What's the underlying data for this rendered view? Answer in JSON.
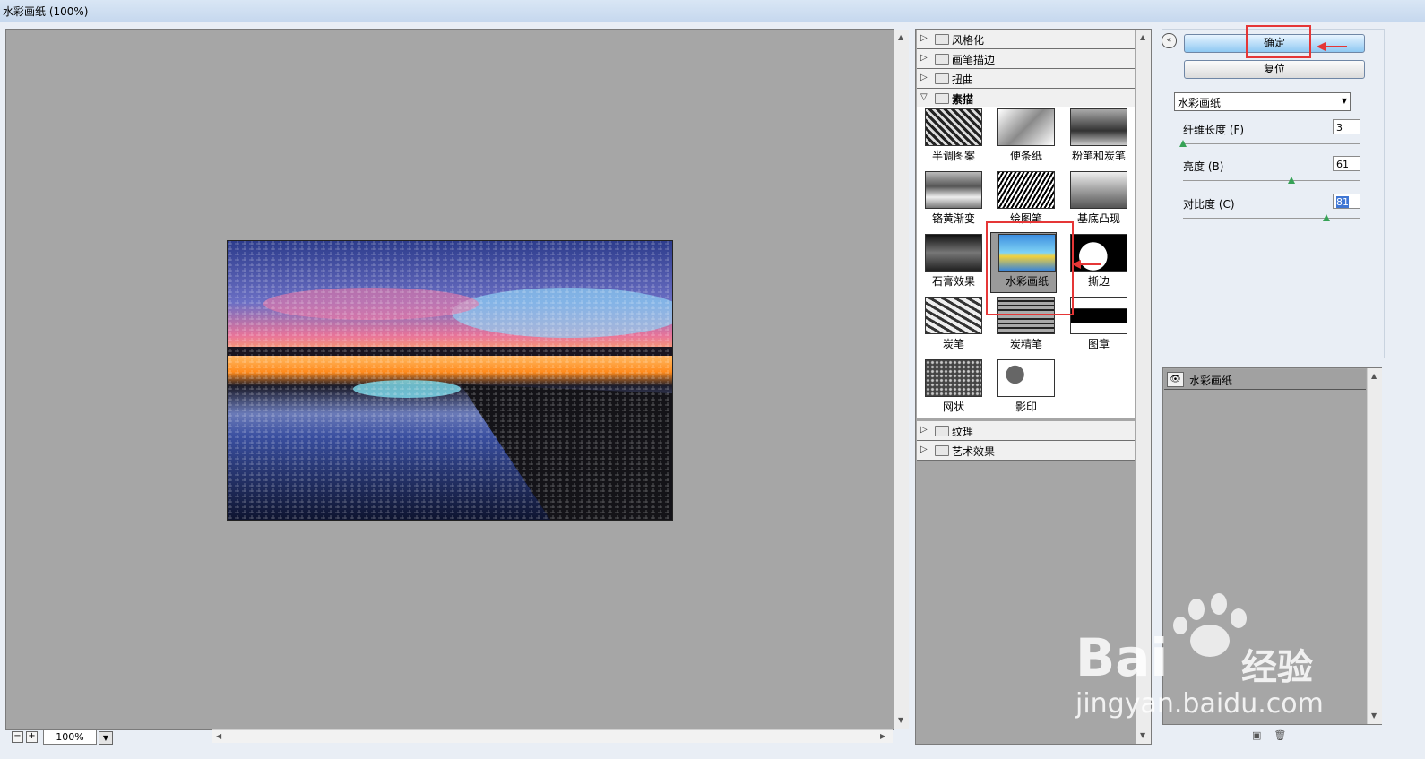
{
  "window": {
    "title": "水彩画纸 (100%)"
  },
  "preview": {
    "zoom": "100%",
    "zoom_out": "−",
    "zoom_in": "+"
  },
  "filter_categories_top": [
    {
      "label": "风格化",
      "open": false
    },
    {
      "label": "画笔描边",
      "open": false
    },
    {
      "label": "扭曲",
      "open": false
    },
    {
      "label": "素描",
      "open": true
    }
  ],
  "sketch_filters": [
    {
      "label": "半调图案"
    },
    {
      "label": "便条纸"
    },
    {
      "label": "粉笔和炭笔"
    },
    {
      "label": "铬黄渐变"
    },
    {
      "label": "绘图笔"
    },
    {
      "label": "基底凸现"
    },
    {
      "label": "石膏效果"
    },
    {
      "label": "水彩画纸",
      "selected": true
    },
    {
      "label": "撕边"
    },
    {
      "label": "炭笔"
    },
    {
      "label": "炭精笔"
    },
    {
      "label": "图章"
    },
    {
      "label": "网状"
    },
    {
      "label": "影印"
    }
  ],
  "filter_categories_bottom": [
    {
      "label": "纹理",
      "open": false
    },
    {
      "label": "艺术效果",
      "open": false
    }
  ],
  "buttons": {
    "ok": "确定",
    "reset": "复位",
    "collapse": "«"
  },
  "filter_select": {
    "value": "水彩画纸"
  },
  "params": [
    {
      "label": "纤维长度 (F)",
      "value": "3",
      "slider_fraction": 0.0
    },
    {
      "label": "亮度 (B)",
      "value": "61",
      "slider_fraction": 0.61
    },
    {
      "label": "对比度 (C)",
      "value": "81",
      "slider_fraction": 0.81
    }
  ],
  "effect_layers": [
    {
      "label": "水彩画纸",
      "visible": true
    }
  ],
  "watermark": {
    "brand": "Bai",
    "brand2": "经验",
    "url": "jingyan.baidu.com"
  }
}
